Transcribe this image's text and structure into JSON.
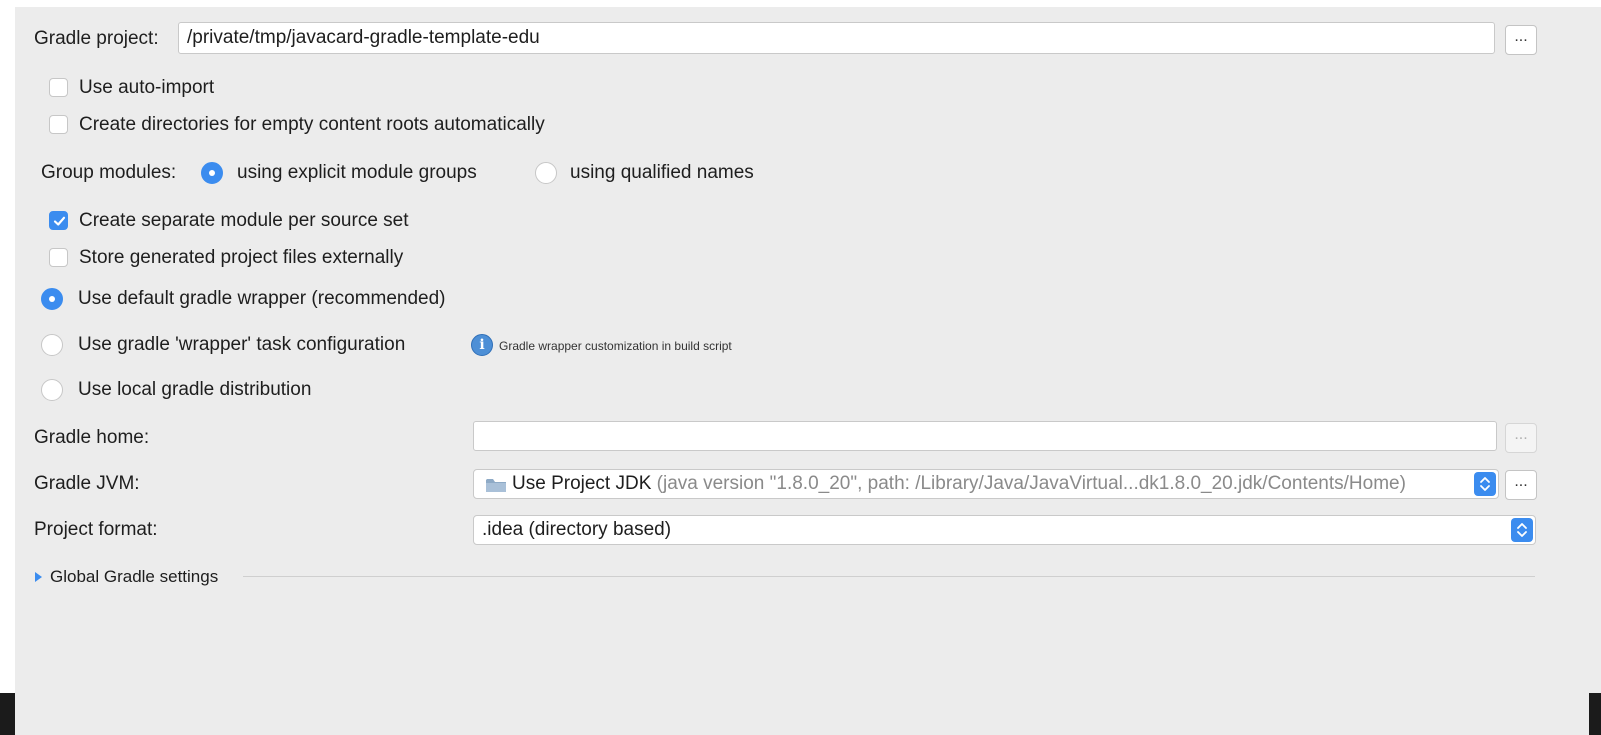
{
  "gradle_project": {
    "label": "Gradle project:",
    "value": "/private/tmp/javacard-gradle-template-edu",
    "browse_label": "..."
  },
  "options": {
    "auto_import": {
      "label": "Use auto-import",
      "checked": false
    },
    "create_dirs": {
      "label": "Create directories for empty content roots automatically",
      "checked": false
    },
    "separate_module": {
      "label": "Create separate module per source set",
      "checked": true
    },
    "store_external": {
      "label": "Store generated project files externally",
      "checked": false
    }
  },
  "group_modules": {
    "label": "Group modules:",
    "options": [
      {
        "label": "using explicit module groups",
        "selected": true
      },
      {
        "label": "using qualified names",
        "selected": false
      }
    ]
  },
  "wrapper": {
    "options": [
      {
        "label": "Use default gradle wrapper (recommended)",
        "selected": true
      },
      {
        "label": "Use gradle 'wrapper' task configuration",
        "selected": false
      },
      {
        "label": "Use local gradle distribution",
        "selected": false
      }
    ],
    "hint": "Gradle wrapper customization in build script"
  },
  "gradle_home": {
    "label": "Gradle home:",
    "value": "",
    "browse_label": "..."
  },
  "gradle_jvm": {
    "label": "Gradle JVM:",
    "selected_main": "Use Project JDK",
    "selected_detail": "(java version \"1.8.0_20\", path: /Library/Java/JavaVirtual...dk1.8.0_20.jdk/Contents/Home)",
    "browse_label": "..."
  },
  "project_format": {
    "label": "Project format:",
    "selected": ".idea (directory based)"
  },
  "global_settings": {
    "label": "Global Gradle settings"
  },
  "colors": {
    "accent": "#3b8cef",
    "panel_bg": "#ececec"
  },
  "icons": {
    "info": "info-icon",
    "folder": "folder-icon",
    "expand": "triangle-right-icon",
    "checkmark": "checkmark-icon",
    "combo_arrows": "up-down-arrows-icon"
  }
}
